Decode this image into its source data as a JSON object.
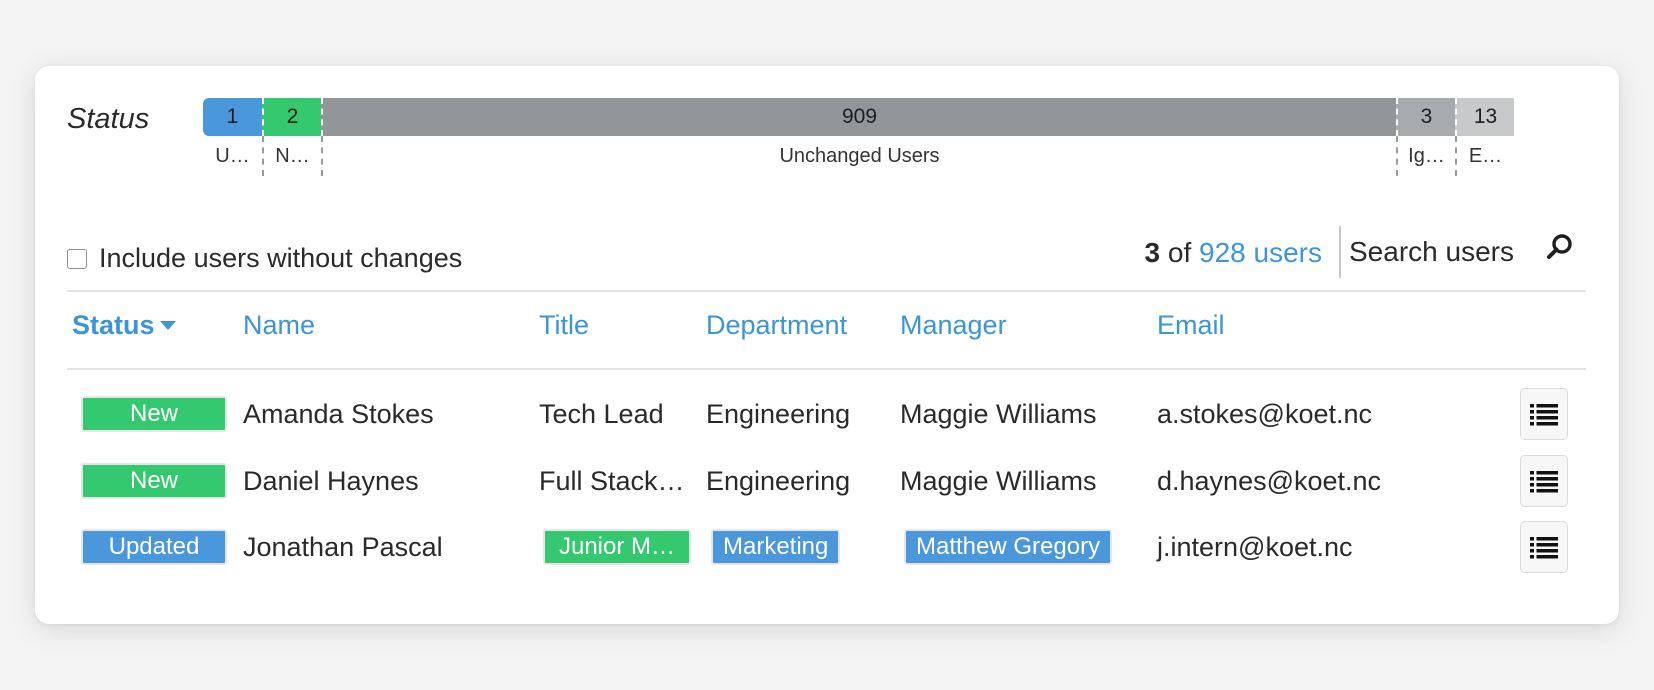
{
  "status_panel": {
    "label": "Status",
    "segments": [
      {
        "count": "1",
        "label": "U…",
        "color": "#4a98db"
      },
      {
        "count": "2",
        "label": "N…",
        "color": "#34c96e"
      },
      {
        "count": "909",
        "label": "Unchanged Users",
        "color": "#939699"
      },
      {
        "count": "3",
        "label": "Ig…",
        "color": "#a8abae"
      },
      {
        "count": "13",
        "label": "E…",
        "color": "#c7c9cb"
      }
    ]
  },
  "toolbar": {
    "include_label": "Include users without changes",
    "include_checked": false,
    "count_shown": "3",
    "count_of": "of",
    "count_total": "928 users",
    "search_placeholder": "Search users",
    "search_icon": "search-icon"
  },
  "table": {
    "columns": [
      "Status",
      "Name",
      "Title",
      "Department",
      "Manager",
      "Email"
    ],
    "sorted_column": "Status",
    "rows": [
      {
        "status": "New",
        "status_color": "#34c96e",
        "name": "Amanda Stokes",
        "title": "Tech Lead",
        "department": "Engineering",
        "manager": "Maggie Williams",
        "email": "a.stokes@koet.nc",
        "action_icon": "list-icon"
      },
      {
        "status": "New",
        "status_color": "#34c96e",
        "name": "Daniel Haynes",
        "title": "Full Stack…",
        "department": "Engineering",
        "manager": "Maggie Williams",
        "email": "d.haynes@koet.nc",
        "action_icon": "list-icon"
      },
      {
        "status": "Updated",
        "status_color": "#4a98db",
        "name": "Jonathan Pascal",
        "title": "Junior M…",
        "title_changed": true,
        "department": "Marketing",
        "department_changed": true,
        "manager": "Matthew Gregory",
        "manager_changed": true,
        "email": "j.intern@koet.nc",
        "action_icon": "list-icon"
      }
    ]
  }
}
